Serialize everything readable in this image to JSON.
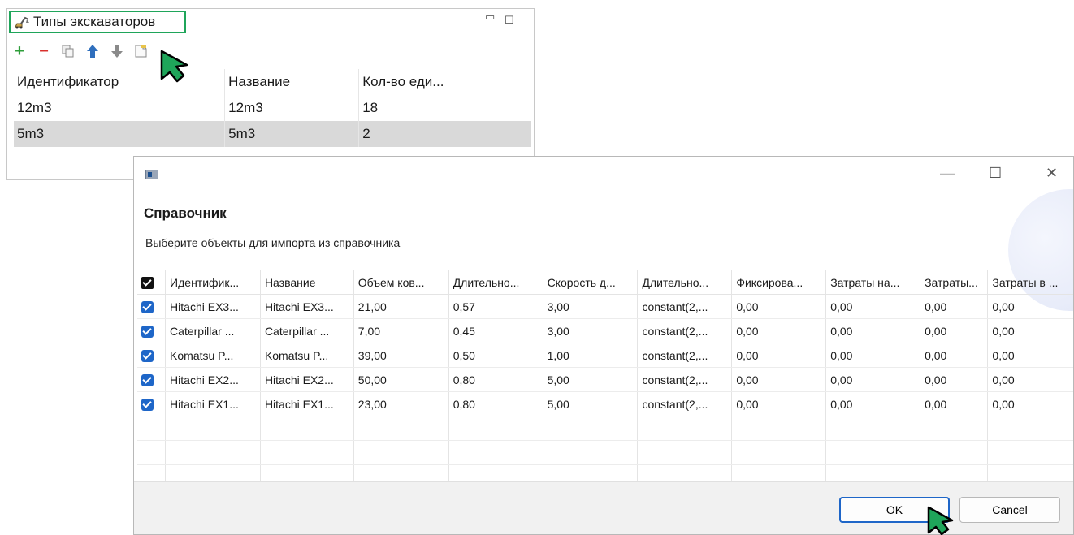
{
  "panel": {
    "title": "Типы экскаваторов",
    "columns": [
      "Идентификатор",
      "Название",
      "Кол-во еди..."
    ],
    "rows": [
      [
        "12m3",
        "12m3",
        "18"
      ],
      [
        "5m3",
        "5m3",
        "2"
      ]
    ],
    "selected_row": 1
  },
  "dialog": {
    "heading": "Справочник",
    "subtitle": "Выберите объекты для импорта из справочника",
    "columns": [
      "Идентифик...",
      "Название",
      "Объем ков...",
      "Длительно...",
      "Скорость д...",
      "Длительно...",
      "Фиксирова...",
      "Затраты на...",
      "Затраты...",
      "Затраты в ..."
    ],
    "rows": [
      [
        "Hitachi EX3...",
        "Hitachi EX3...",
        "21,00",
        "0,57",
        "3,00",
        "constant(2,...",
        "0,00",
        "0,00",
        "0,00",
        "0,00"
      ],
      [
        "Caterpillar ...",
        "Caterpillar ...",
        "7,00",
        "0,45",
        "3,00",
        "constant(2,...",
        "0,00",
        "0,00",
        "0,00",
        "0,00"
      ],
      [
        "Komatsu P...",
        "Komatsu P...",
        "39,00",
        "0,50",
        "1,00",
        "constant(2,...",
        "0,00",
        "0,00",
        "0,00",
        "0,00"
      ],
      [
        "Hitachi EX2...",
        "Hitachi EX2...",
        "50,00",
        "0,80",
        "5,00",
        "constant(2,...",
        "0,00",
        "0,00",
        "0,00",
        "0,00"
      ],
      [
        "Hitachi EX1...",
        "Hitachi EX1...",
        "23,00",
        "0,80",
        "5,00",
        "constant(2,...",
        "0,00",
        "0,00",
        "0,00",
        "0,00"
      ]
    ],
    "ok_label": "OK",
    "cancel_label": "Cancel"
  },
  "colors": {
    "accent": "#1e66c8",
    "highlight": "#1fa55a",
    "add": "#2e9e3a",
    "remove": "#d9302c",
    "move": "#2f6fbd"
  }
}
